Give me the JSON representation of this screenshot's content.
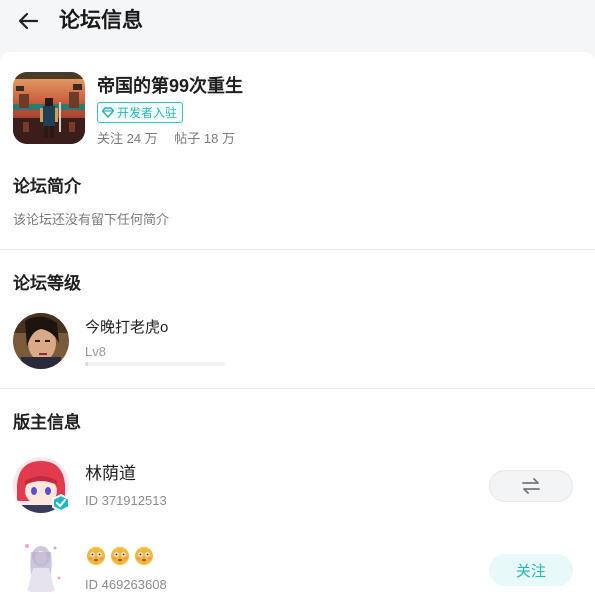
{
  "header": {
    "title": "论坛信息",
    "back_icon": "arrow-left-icon"
  },
  "forum": {
    "name": "帝国的第99次重生",
    "badge_label": "开发者入驻",
    "badge_icon": "diamond-icon",
    "followers": "关注 24 万",
    "posts": "帖子 18 万"
  },
  "intro": {
    "title": "论坛简介",
    "text": "该论坛还没有留下任何简介"
  },
  "level": {
    "title": "论坛等级",
    "user_name": "今晚打老虎o",
    "level_label": "Lv8",
    "progress": 0.02
  },
  "moderators": {
    "title": "版主信息",
    "items": [
      {
        "name": "林荫道",
        "id_text": "ID 371912513",
        "action_icon": "swap-icon"
      },
      {
        "name": "",
        "id_text": "ID 469263608",
        "action_label": "关注"
      }
    ]
  },
  "colors": {
    "accent": "#23b8b5",
    "accent_bg": "#e8f9f9",
    "text_primary": "#1f1f1f",
    "text_secondary": "#7a7a7a",
    "page_bg": "#f5f6f8"
  }
}
